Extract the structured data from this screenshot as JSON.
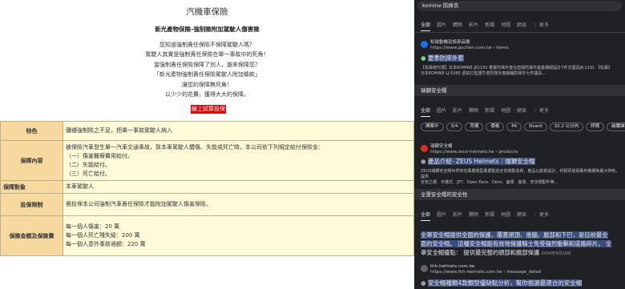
{
  "left": {
    "title": "汽機車保險",
    "subtitle": "新光產物保險-強制險附加駕駛人傷害險",
    "lines": [
      "您知道強制責任保險不保障駕駛人嗎？",
      "駕駛人其實是強制責任保險在單一事故中的死角！",
      "當強制責任保險保障了別人，誰來保障您？",
      "「新光產物強制責任保險駕駛人附加條款」",
      "讓您的保障無死角！",
      "以少少的花費，獲得大大的保障。"
    ],
    "button": "線上試算投保",
    "table": [
      {
        "label": "特色",
        "lines": [
          "彌補強制險之不足，把單一事故駕駛人納入"
        ]
      },
      {
        "label": "保障內容",
        "lines": [
          "被保險汽車發生單一汽車交通事故，致本車駕駛人體傷、失能或死亡時，本公司依下列規定給付保險金：",
          "（一）傷害醫療費用給付。",
          "（二）失能給付。",
          "（三）死亡給付。"
        ]
      },
      {
        "label": "保障對象",
        "lines": [
          "本車駕駛人"
        ]
      },
      {
        "label": "投保限制",
        "lines": [
          "需投保本公司強制汽車責任保險才能附加駕駛人傷害保險。"
        ]
      },
      {
        "label": "保險金額及保險費",
        "lines": [
          "每一個人傷害：20 萬",
          "每一個人死亡殘失級：200 萬",
          "每一個人意外事故適額：220 萬"
        ]
      }
    ]
  },
  "right": {
    "s1": {
      "query": "komine 防摔衣",
      "tabs": [
        "全部",
        "圖片",
        "購物",
        "影片",
        "新聞",
        "地圖",
        "網頁",
        "⋮ 更多"
      ],
      "site_name": "松霖動機及設部品展",
      "site_url": "https://www.gochen.com.tw › items",
      "link": "夏季防摔外套",
      "snippet1": "【松霖總代理】日本KOMINE JK1191 春夏防摔外套台直營防摔外套金網眼設計7件式護具JK-1191 【松霖】",
      "snippet2": "日本KOMINE LJ-5365 透氣打型護牛皮防摔外套鉚縮防摔衣七件護具..."
    },
    "s2": {
      "query": "瑞獅安全帽",
      "tabs": [
        "全部",
        "圖片",
        "影片",
        "購物",
        "新聞",
        "地圖",
        "網頁",
        "⋮ 更多"
      ],
      "chips": [
        "開案中",
        "3/4",
        "背襯",
        "價格",
        "Pit",
        "Dcard",
        "32.2 公分內",
        "評價",
        "碳纖維"
      ],
      "site_name": "瑞獅安全帽",
      "site_url": "https://www.zeus-helmets.tw › products",
      "link": "產品介紹- ZEUS Helmets｜瑞獅安全帽",
      "snippet1": "ZEUS瑞獅安全帽世界知名專業帽型專業製造全安帽製造商，產品以創新設計，材質研發與專利機構為最大特色，提供",
      "snippet2": "全安之選．可選式．JET．Open Face．Dens．面罩．盔罩．安全帽配件等..."
    },
    "s3": {
      "query": "全罩安全帽的安全性",
      "tabs": [
        "全部",
        "圖片",
        "影片",
        "購物",
        "新聞",
        "地圖",
        "網頁",
        "⋮ 更多"
      ],
      "snippet": [
        "全罩安全帽提供全面的保護，覆蓋頭頂、後腦、臉部和下巴，是目前最全",
        "面的安全帽。 這種安全帽能有效地保護騎士免受強烈衝擊和道路碎片。 全",
        "罩安全帽優點： 提供最完整的頭部和臉部保護"
      ],
      "date": "2024年9月19日",
      "site_name": "thh-helmets.com.tw",
      "site_url": "https://www.thh-helmets.com.tw › message_detail",
      "link": "安全帽種類4款類型優缺點分析，幫你挑選最適合的安全帽"
    }
  }
}
